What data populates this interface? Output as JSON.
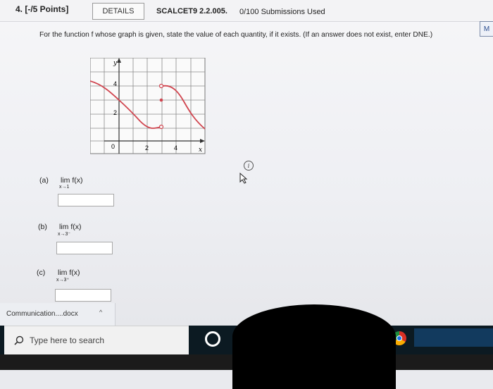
{
  "header": {
    "question_number": "4. [-/5 Points]",
    "details_label": "DETAILS",
    "course_code": "SCALCET9 2.2.005.",
    "submissions": "0/100 Submissions Used",
    "side_button": "M"
  },
  "question": {
    "prompt": "For the function f whose graph is given, state the value of each quantity, if it exists. (If an answer does not exist, enter DNE.)"
  },
  "graph": {
    "y_axis_label": "y",
    "x_axis_label": "x",
    "origin_label": "0",
    "y_tick_labels": [
      "2",
      "4"
    ],
    "x_tick_labels": [
      "2",
      "4"
    ]
  },
  "parts": [
    {
      "label": "(a)",
      "expr": "lim f(x)",
      "sub": "x→1",
      "answer": ""
    },
    {
      "label": "(b)",
      "expr": "lim f(x)",
      "sub": "x→3⁻",
      "answer": ""
    },
    {
      "label": "(c)",
      "expr": "lim f(x)",
      "sub": "x→3⁺",
      "answer": ""
    }
  ],
  "info_icon": "i",
  "download_bar": {
    "file_name": "Communication....docx",
    "chevron": "^"
  },
  "taskbar": {
    "search_placeholder": "Type here to search"
  },
  "colors": {
    "curve": "#d0454f",
    "grid": "#7a7a7a",
    "taskbar": "#0c1a22"
  }
}
